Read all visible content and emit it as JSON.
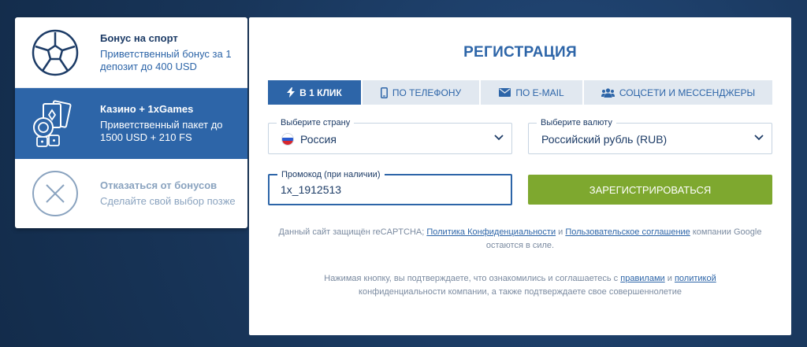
{
  "bonuses": [
    {
      "title": "Бонус на спорт",
      "desc": "Приветственный бонус за 1 депозит до 400 USD",
      "icon": "soccer-ball-icon"
    },
    {
      "title": "Казино + 1xGames",
      "desc": "Приветственный пакет до 1500 USD + 210 FS",
      "icon": "casino-cards-icon"
    },
    {
      "title": "Отказаться от бонусов",
      "desc": "Сделайте свой выбор позже",
      "icon": "close-circle-icon"
    }
  ],
  "registration": {
    "title": "РЕГИСТРАЦИЯ",
    "tabs": [
      {
        "label": "В 1 КЛИК",
        "icon": "lightning-icon",
        "active": true
      },
      {
        "label": "ПО ТЕЛЕФОНУ",
        "icon": "phone-icon",
        "active": false
      },
      {
        "label": "ПО E-MAIL",
        "icon": "envelope-icon",
        "active": false
      },
      {
        "label": "СОЦСЕТИ И МЕССЕНДЖЕРЫ",
        "icon": "users-icon",
        "active": false
      }
    ],
    "country": {
      "label": "Выберите страну",
      "value": "Россия"
    },
    "currency": {
      "label": "Выберите валюту",
      "value": "Российский рубль (RUB)"
    },
    "promo": {
      "label": "Промокод (при наличии)",
      "value": "1x_1912513"
    },
    "register_button": "ЗАРЕГИСТРИРОВАТЬСЯ",
    "recaptcha": {
      "prefix": "Данный сайт защищён reCAPTCHA; ",
      "privacy_link": "Политика Конфиденциальности",
      "and": " и ",
      "terms_link": "Пользовательское соглашение",
      "suffix": " компании Google остаются в силе."
    },
    "confirm": {
      "prefix": "Нажимая кнопку, вы подтверждаете, что ознакомились и соглашаетесь с ",
      "rules_link": "правилами",
      "and": " и ",
      "policy_link": "политикой",
      "suffix": " конфиденциальности компании, а также подтверждаете свое совершеннолетие"
    }
  },
  "colors": {
    "accent": "#2d65a8",
    "button": "#7ea82f",
    "background": "#1b3a63"
  }
}
